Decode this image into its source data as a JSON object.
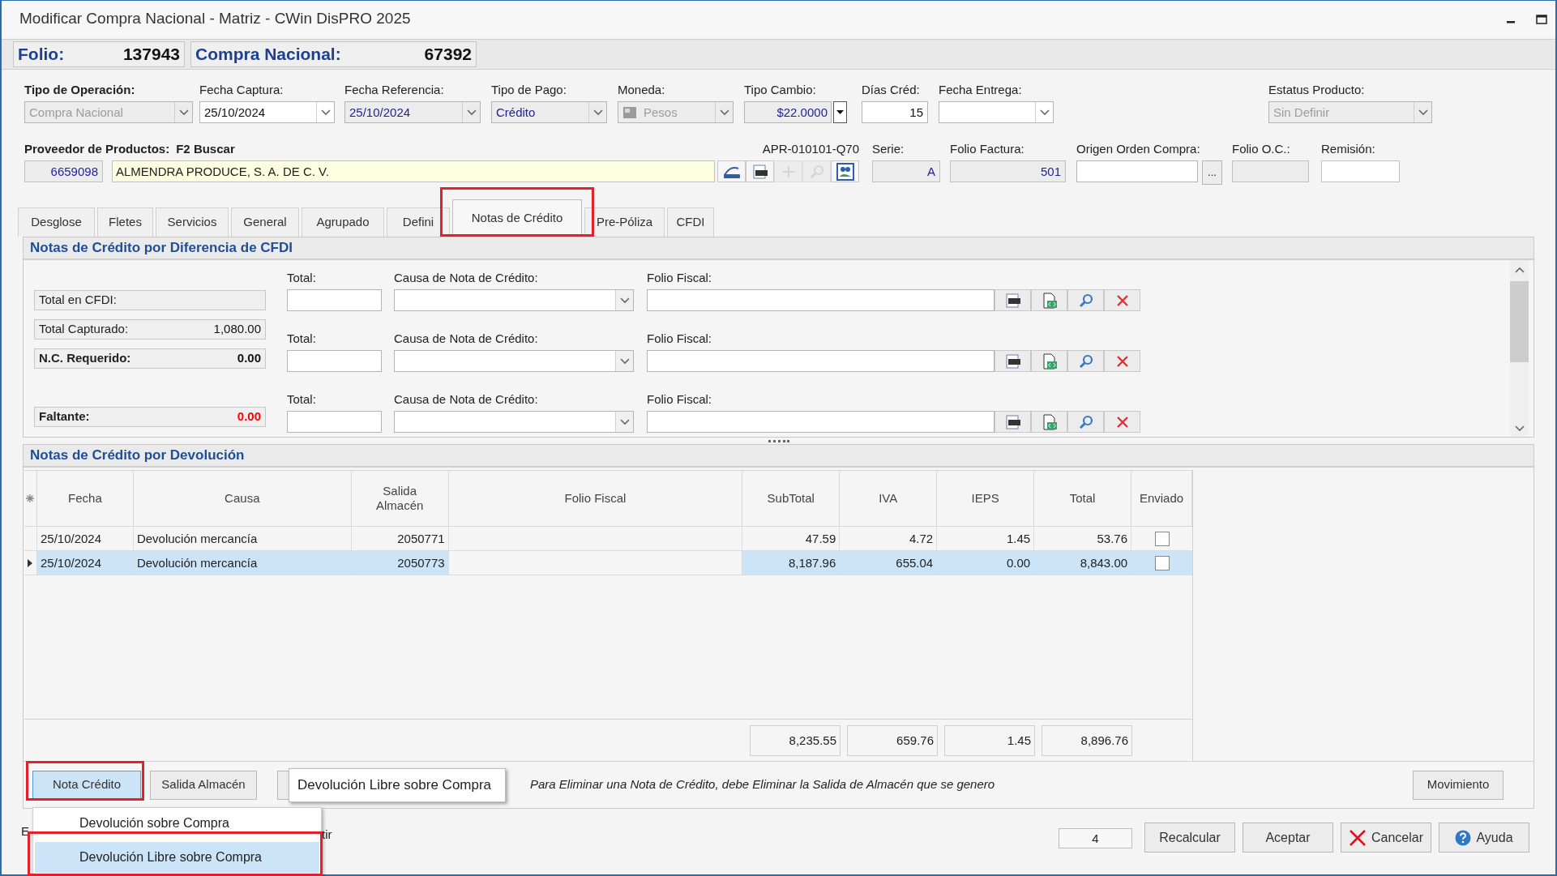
{
  "window": {
    "title": "Modificar Compra Nacional - Matriz - CWin DisPRO 2025"
  },
  "header": [
    {
      "label": "Folio:",
      "value": "137943"
    },
    {
      "label": "Compra Nacional:",
      "value": "67392"
    }
  ],
  "fields": [
    {
      "label": "Tipo de Operación:",
      "label_bold": true,
      "kind": "combo",
      "disabled": true,
      "value": "Compra Nacional"
    },
    {
      "label": "Fecha Captura:",
      "label_bold": false,
      "kind": "combo",
      "disabled": false,
      "read_only": false,
      "value": "25/10/2024"
    },
    {
      "label": "Fecha Referencia:",
      "label_bold": false,
      "kind": "combo",
      "disabled": false,
      "read_only": true,
      "value": "25/10/2024"
    },
    {
      "label": "Tipo de Pago:",
      "label_bold": false,
      "kind": "combo",
      "disabled": false,
      "read_only": true,
      "value": "Crédito"
    },
    {
      "label": "Moneda:",
      "label_bold": false,
      "kind": "flag_combo",
      "disabled": true,
      "value": "Pesos"
    },
    {
      "label": "Tipo Cambio:",
      "label_bold": false,
      "kind": "spin",
      "disabled": false,
      "read_only": true,
      "value": "$22.0000"
    },
    {
      "label": "Días Créd:",
      "label_bold": false,
      "kind": "number",
      "disabled": false,
      "read_only": false,
      "value": "15"
    },
    {
      "label": "Fecha Entrega:",
      "label_bold": false,
      "kind": "combo",
      "disabled": false,
      "read_only": false
    },
    {
      "label": "Estatus Producto:",
      "label_bold": false,
      "kind": "combo",
      "disabled": true,
      "value": "Sin Definir"
    }
  ],
  "supplier": {
    "label": "Proveedor de Productos:",
    "hint": "F2 Buscar",
    "code": "6659098",
    "name": "ALMENDRA PRODUCE, S. A. DE C. V.",
    "rfc": "APR-010101-Q70",
    "tools": [
      {
        "kind": "scanner",
        "disabled": false
      },
      {
        "kind": "xml",
        "disabled": false
      },
      {
        "kind": "add",
        "disabled": true
      },
      {
        "kind": "search",
        "disabled": true
      },
      {
        "kind": "contacts",
        "disabled": false
      }
    ]
  },
  "invoice_fields": [
    {
      "label": "Serie:",
      "kind": "text",
      "read_only": true,
      "value": "A"
    },
    {
      "label": "Folio Factura:",
      "kind": "text",
      "read_only": true,
      "value": "501"
    },
    {
      "label": "Origen Orden Compra:",
      "kind": "lookup",
      "read_only": false,
      "button": "..."
    },
    {
      "label": "Folio O.C.:",
      "kind": "text",
      "read_only": true
    },
    {
      "label": "Remisión:",
      "kind": "text",
      "read_only": false
    }
  ],
  "tabs": [
    {
      "label": "Desglose",
      "selected": false,
      "highlighted": false
    },
    {
      "label": "Fletes",
      "selected": false,
      "highlighted": false
    },
    {
      "label": "Servicios",
      "selected": false,
      "highlighted": false
    },
    {
      "label": "General",
      "selected": false,
      "highlighted": false
    },
    {
      "label": "Agrupado",
      "selected": false,
      "highlighted": false
    },
    {
      "label": "Defini",
      "selected": false,
      "highlighted": false
    },
    {
      "label": "Notas de Crédito",
      "selected": true,
      "highlighted": true
    },
    {
      "label": "Pre-Póliza",
      "selected": false,
      "highlighted": false
    },
    {
      "label": "CFDI",
      "selected": false,
      "highlighted": false
    }
  ],
  "cfdi_panel": {
    "title": "Notas de Crédito por Diferencia de CFDI",
    "summary": [
      {
        "label": "Total en CFDI:",
        "bold": false
      },
      {
        "label": "Total Capturado:",
        "value": "1,080.00",
        "bold": false,
        "alert": false
      },
      {
        "label": "N.C. Requerido:",
        "value": "0.00",
        "bold": true,
        "alert": false
      },
      {
        "label": "Faltante:",
        "value": "0.00",
        "bold": true,
        "alert": true
      }
    ],
    "notes": [
      {
        "total_label": "Total:",
        "cause_label": "Causa de Nota de Crédito:",
        "folio_label": "Folio Fiscal:"
      },
      {
        "total_label": "Total:",
        "cause_label": "Causa de Nota de Crédito:",
        "folio_label": "Folio Fiscal:"
      },
      {
        "total_label": "Total:",
        "cause_label": "Causa de Nota de Crédito:",
        "folio_label": "Folio Fiscal:"
      }
    ]
  },
  "returns_panel": {
    "title": "Notas de Crédito por Devolución",
    "columns": [
      "Fecha",
      "Causa",
      "Salida Almacén",
      "Folio Fiscal",
      "SubTotal",
      "IVA",
      "IEPS",
      "Total",
      "Enviado"
    ],
    "rows": [
      {
        "fecha": "25/10/2024",
        "causa": "Devolución mercancía",
        "salida": "2050771",
        "subtotal": "47.59",
        "iva": "4.72",
        "ieps": "1.45",
        "total": "53.76",
        "sent": false,
        "selected": false
      },
      {
        "fecha": "25/10/2024",
        "causa": "Devolución mercancía",
        "salida": "2050773",
        "subtotal": "8,187.96",
        "iva": "655.04",
        "ieps": "0.00",
        "total": "8,843.00",
        "sent": false,
        "selected": true
      }
    ],
    "totals": {
      "subtotal": "8,235.55",
      "iva": "659.76",
      "ieps": "1.45",
      "total": "8,896.76"
    }
  },
  "toolbar": {
    "buttons": [
      {
        "label": "Nota Crédito",
        "pressed": true,
        "highlighted": true
      },
      {
        "label": "Salida Almacén",
        "pressed": false,
        "highlighted": false
      }
    ],
    "tooltip": "Devolución Libre sobre Compra",
    "note": "Para Eliminar una Nota de Crédito, debe Eliminar la Salida de Almacén que se genero",
    "action": "Movimiento"
  },
  "menu": [
    {
      "label": "Devolución sobre Compra",
      "selected": false,
      "highlighted": false
    },
    {
      "label": "Devolución Libre sobre Compra",
      "selected": true,
      "highlighted": true
    }
  ],
  "footer": {
    "fragments": [
      "E",
      "tir"
    ],
    "counter": "4",
    "buttons": [
      {
        "label": "Recalcular",
        "kind": "plain"
      },
      {
        "label": "Aceptar",
        "kind": "plain"
      },
      {
        "label": "Cancelar",
        "kind": "cancel"
      },
      {
        "label": "Ayuda",
        "kind": "help"
      }
    ]
  }
}
